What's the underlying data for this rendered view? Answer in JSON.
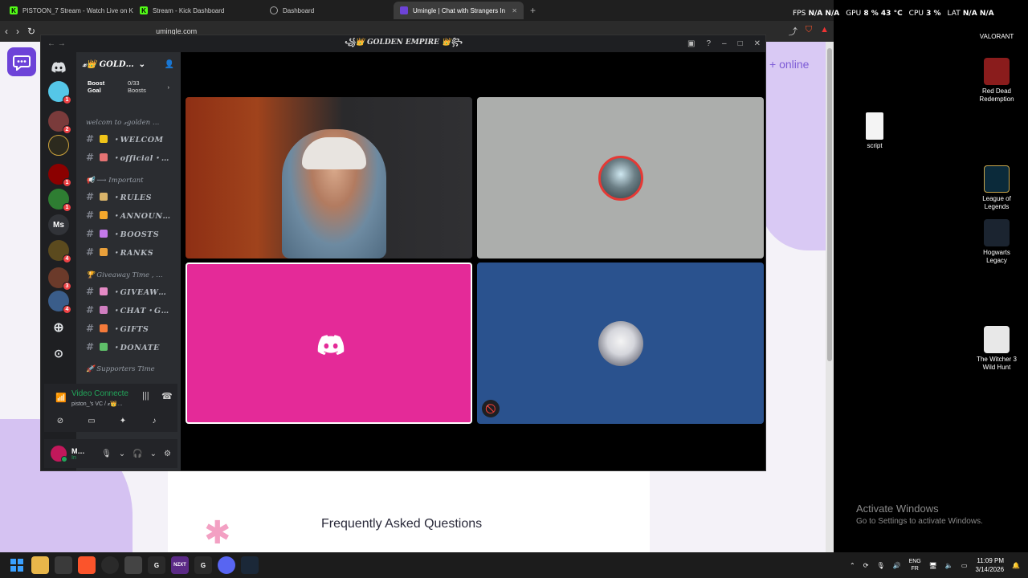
{
  "browser": {
    "tabs": [
      {
        "label": "PISTOON_7 Stream - Watch Live on K",
        "icon": "kick-icon",
        "color": "#53fc18",
        "active": false
      },
      {
        "label": "Stream - Kick Dashboard",
        "icon": "kick-icon",
        "color": "#53fc18",
        "active": false
      },
      {
        "label": "Dashboard",
        "icon": "globe-icon",
        "color": "#888888",
        "active": false
      },
      {
        "label": "Umingle | Chat with Strangers In",
        "icon": "umingle-icon",
        "color": "#6d43d8",
        "active": true
      }
    ],
    "new_tab": "+",
    "url": "umingle.com"
  },
  "overlay": {
    "fps_label": "FPS",
    "fps": "N/A",
    "fps2": "N/A",
    "gpu_label": "GPU",
    "gpu_usage": "8 %",
    "gpu_temp": "43 °C",
    "cpu_label": "CPU",
    "cpu_usage": "3 %",
    "lat_label": "LAT",
    "lat": "N/A",
    "lat2": "N/A"
  },
  "page": {
    "online_text": "+ online",
    "faq_title": "Frequently Asked Questions"
  },
  "discord": {
    "window_title": "꧁👑 GOLDEN EMPIRE 👑꧂",
    "server_name": "𝓍👑 GOLD…",
    "boost_goal": "Boost Goal",
    "boost_count": "0/33 Boosts",
    "categories": [
      "welcom to 𝓍golden …",
      "📢 ⟶ Important",
      "🏆 Giveaway Time , …",
      "🚀 Supporters Time"
    ],
    "channels": [
      {
        "name": "・WELCOM",
        "emoji_color": "#f0c419"
      },
      {
        "name": "・official・…",
        "emoji_color": "#e57373"
      },
      {
        "name": "・RULES",
        "emoji_color": "#d9b46a"
      },
      {
        "name": "・ANNOUN…",
        "emoji_color": "#f4a82c"
      },
      {
        "name": "・BOOSTS",
        "emoji_color": "#c479ea"
      },
      {
        "name": "・RANKS",
        "emoji_color": "#e9a03b"
      },
      {
        "name": "・GIVEAW…",
        "emoji_color": "#e58ac5"
      },
      {
        "name": "・CHAT・G…",
        "emoji_color": "#d07ec0"
      },
      {
        "name": "・GIFTS",
        "emoji_color": "#f47a3a"
      },
      {
        "name": "・DONATE",
        "emoji_color": "#5fbf69"
      }
    ],
    "guild_badges": [
      "1",
      "2",
      "1",
      "1",
      "4",
      "3",
      "4"
    ],
    "guild_ms": "Ms",
    "voice": {
      "status": "Video Connecte",
      "channel": "piston_'s VC / 𝓍👑…"
    },
    "user": {
      "name": "M…",
      "status": "In"
    }
  },
  "desktop": {
    "icons": [
      {
        "label": "VALORANT"
      },
      {
        "label": "Red Dead Redemption"
      },
      {
        "label": "script"
      },
      {
        "label": "League of Legends"
      },
      {
        "label": "Hogwarts Legacy"
      },
      {
        "label": "The Witcher 3 Wild Hunt"
      }
    ],
    "activate_title": "Activate Windows",
    "activate_sub": "Go to Settings to activate Windows."
  },
  "taskbar": {
    "lang1": "ENG",
    "lang2": "FR",
    "time": "11:09 PM",
    "date": "3/14/2026",
    "nzxt": "NZXT"
  }
}
